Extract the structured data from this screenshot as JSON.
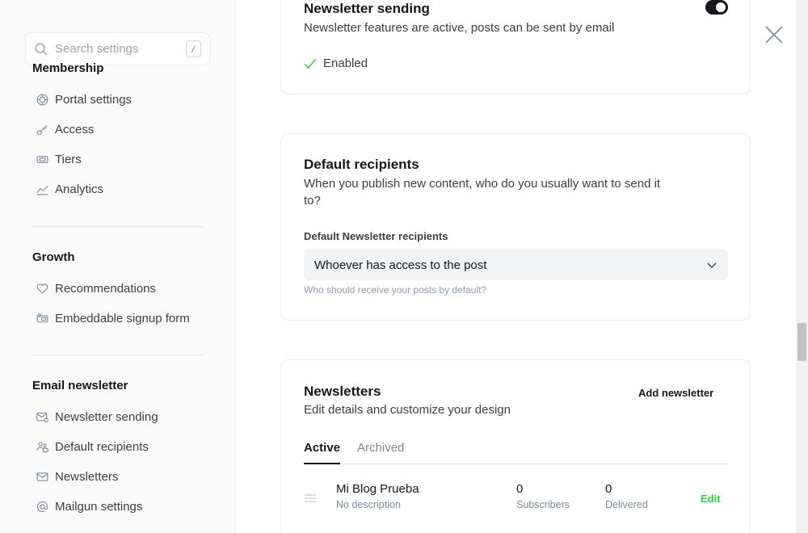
{
  "search": {
    "placeholder": "Search settings",
    "shortcut": "/"
  },
  "sidebar": {
    "membership": {
      "title": "Membership",
      "items": [
        {
          "label": "Portal settings",
          "icon": "portal-icon"
        },
        {
          "label": "Access",
          "icon": "key-icon"
        },
        {
          "label": "Tiers",
          "icon": "ticket-icon"
        },
        {
          "label": "Analytics",
          "icon": "chart-icon"
        }
      ]
    },
    "growth": {
      "title": "Growth",
      "items": [
        {
          "label": "Recommendations",
          "icon": "heart-icon"
        },
        {
          "label": "Embeddable signup form",
          "icon": "signup-form-icon"
        }
      ]
    },
    "email": {
      "title": "Email newsletter",
      "items": [
        {
          "label": "Newsletter sending",
          "icon": "mail-settings-icon"
        },
        {
          "label": "Default recipients",
          "icon": "users-icon"
        },
        {
          "label": "Newsletters",
          "icon": "mail-icon"
        },
        {
          "label": "Mailgun settings",
          "icon": "at-icon"
        }
      ]
    }
  },
  "newsletter_sending": {
    "title": "Newsletter sending",
    "description": "Newsletter features are active, posts can be sent by email",
    "status": "Enabled",
    "toggle_on": true
  },
  "default_recipients": {
    "title": "Default recipients",
    "description": "When you publish new content, who do you usually want to send it to?",
    "field_label": "Default Newsletter recipients",
    "selected": "Whoever has access to the post",
    "hint": "Who should receive your posts by default?"
  },
  "newsletters": {
    "title": "Newsletters",
    "description": "Edit details and customize your design",
    "add_label": "Add newsletter",
    "tabs": [
      {
        "label": "Active",
        "active": true
      },
      {
        "label": "Archived",
        "active": false
      }
    ],
    "rows": [
      {
        "name": "Mi Blog Prueba",
        "description": "No description",
        "subscribers": "0",
        "subscribers_label": "Subscribers",
        "delivered": "0",
        "delivered_label": "Delivered",
        "edit_label": "Edit"
      }
    ]
  },
  "colors": {
    "accent": "#30cf43",
    "toggle": "#15171a",
    "check": "#30cf43"
  }
}
